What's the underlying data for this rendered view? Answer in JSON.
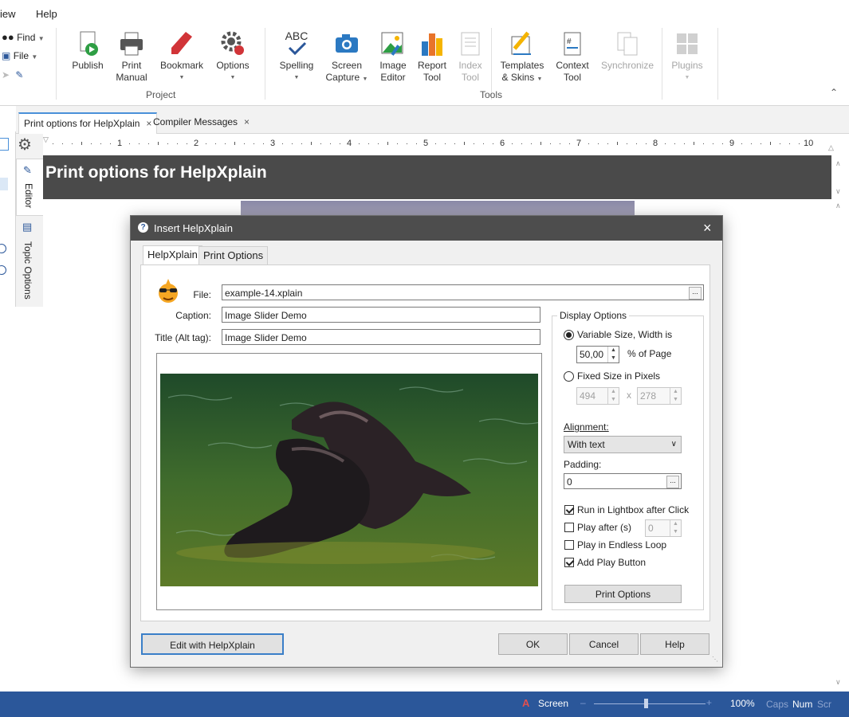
{
  "menubar": {
    "items": [
      "iew",
      "Help"
    ]
  },
  "quick": {
    "find": "Find",
    "file": "File"
  },
  "ribbon": {
    "project": {
      "label": "Project",
      "publish": "Publish",
      "print_manual": [
        "Print",
        "Manual"
      ],
      "bookmark": "Bookmark",
      "options": "Options"
    },
    "tools": {
      "label": "Tools",
      "spelling": "Spelling",
      "spelling_icon_text": "ABC",
      "screen_capture": [
        "Screen",
        "Capture"
      ],
      "image_editor": [
        "Image",
        "Editor"
      ],
      "report_tool": [
        "Report",
        "Tool"
      ],
      "index_tool": [
        "Index",
        "Tool"
      ],
      "templates": [
        "Templates",
        "& Skins"
      ],
      "context_tool": [
        "Context",
        "Tool"
      ],
      "synchronize": "Synchronize",
      "plugins": "Plugins"
    }
  },
  "side_tabs": {
    "editor": "Editor",
    "topic_options": "Topic Options"
  },
  "doc_tabs": [
    {
      "label": "Print options for HelpXplain"
    },
    {
      "label": "Compiler Messages"
    }
  ],
  "ruler": {
    "numbers": [
      "1",
      "2",
      "3",
      "4",
      "5",
      "6",
      "7",
      "8",
      "9",
      "10"
    ]
  },
  "editor": {
    "title": "Print options for HelpXplain"
  },
  "dialog": {
    "title": "Insert HelpXplain",
    "tabs": [
      "HelpXplain",
      "Print Options"
    ],
    "file_label": "File:",
    "file_value": "example-14.xplain",
    "browse": "...",
    "caption_label": "Caption:",
    "caption_value": "Image Slider Demo",
    "title_label": "Title (Alt tag):",
    "title_value": "Image Slider Demo",
    "display_options": {
      "legend": "Display Options",
      "variable_size": "Variable Size, Width is",
      "width_value": "50,00",
      "percent_label": "% of Page",
      "fixed_size": "Fixed Size in Pixels",
      "px_width": "494",
      "px_x": "x",
      "px_height": "278",
      "alignment_label": "Alignment:",
      "alignment_value": "With text",
      "padding_label": "Padding:",
      "padding_value": "0",
      "run_lightbox": "Run in Lightbox after Click",
      "play_after": "Play after (s)",
      "play_after_value": "0",
      "endless_loop": "Play in Endless Loop",
      "add_play_button": "Add Play Button",
      "print_options_button": "Print Options"
    },
    "buttons": {
      "edit": "Edit with HelpXplain",
      "ok": "OK",
      "cancel": "Cancel",
      "help": "Help"
    }
  },
  "status": {
    "screen": "Screen",
    "zoom": "100%",
    "caps": "Caps",
    "num": "Num",
    "scr": "Scr"
  },
  "colors": {
    "statusbar": "#2b579a",
    "title_bar": "#4a4a4a",
    "dialog_title": "#4d4d4d",
    "accent": "#4a90d9"
  }
}
